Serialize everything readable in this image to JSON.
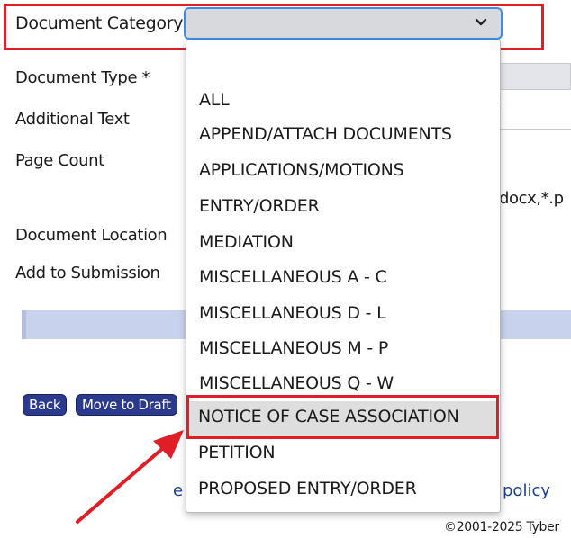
{
  "form": {
    "document_category_label": "Document Category",
    "document_type_label": "Document Type *",
    "additional_text_label": "Additional Text",
    "page_count_label": "Page Count",
    "file_types_partial": "docx,*.p",
    "document_location_label": "Document Location",
    "add_to_submission_label": "Add to Submission"
  },
  "select": {
    "value": ""
  },
  "dropdown": {
    "options": [
      "",
      "ALL",
      "APPEND/ATTACH DOCUMENTS",
      "APPLICATIONS/MOTIONS",
      "ENTRY/ORDER",
      "MEDIATION",
      "MISCELLANEOUS A - C",
      "MISCELLANEOUS D - L",
      "MISCELLANEOUS M - P",
      "MISCELLANEOUS Q - W",
      "NOTICE OF CASE ASSOCIATION",
      "PETITION",
      "PROPOSED ENTRY/ORDER"
    ],
    "hovered_option": "NOTICE OF CASE ASSOCIATION"
  },
  "buttons": {
    "back": "Back",
    "move_to_draft": "Move to Draft"
  },
  "footer": {
    "left_link_partial": "e",
    "right_link_partial": "policy",
    "copyright": "©2001-2025 Tyber"
  },
  "colors": {
    "annotation_red": "#e01e26",
    "button_navy": "#2b3a8c",
    "select_border": "#3b8ee6",
    "link_blue": "#1a3f8f"
  }
}
